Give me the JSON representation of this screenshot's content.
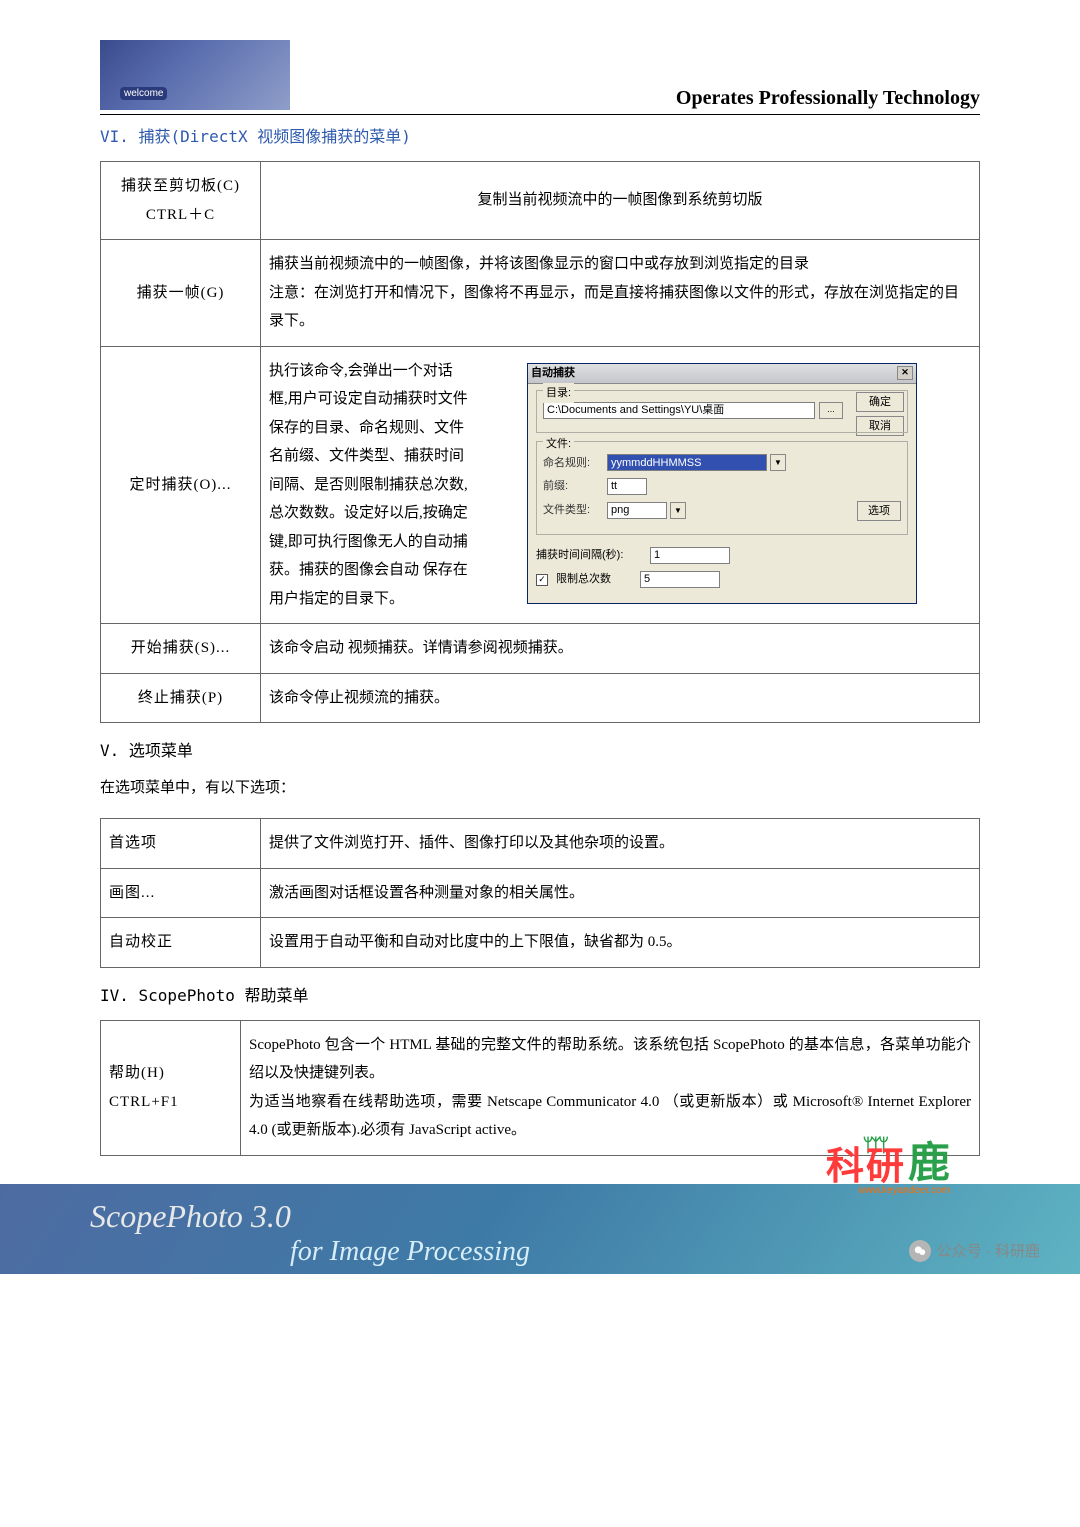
{
  "header": {
    "title": "Operates Professionally Technology"
  },
  "section6_title": "VI. 捕获(DirectX 视频图像捕获的菜单)",
  "table1": {
    "r1": {
      "label": "捕获至剪切板(C)   CTRL＋C",
      "desc": "复制当前视频流中的一帧图像到系统剪切版"
    },
    "r2": {
      "label": "捕获一帧(G)",
      "desc": "捕获当前视频流中的一帧图像，并将该图像显示的窗口中或存放到浏览指定的目录\n注意：在浏览打开和情况下，图像将不再显示，而是直接将捕获图像以文件的形式，存放在浏览指定的目录下。"
    },
    "r3": {
      "label": "定时捕获(O)...",
      "desc": "执行该命令,会弹出一个对话框,用户可设定自动捕获时文件保存的目录、命名规则、文件名前缀、文件类型、捕获时间间隔、是否则限制捕获总次数,总次数数。设定好以后,按确定键,即可执行图像无人的自动捕获。捕获的图像会自动 保存在用户指定的目录下。"
    },
    "r4": {
      "label": "开始捕获(S)...",
      "desc": "该命令启动 视频捕获。详情请参阅视频捕获。"
    },
    "r5": {
      "label": "终止捕获(P)",
      "desc": "该命令停止视频流的捕获。"
    }
  },
  "dialog": {
    "title": "自动捕获",
    "ok": "确定",
    "cancel": "取消",
    "grp_dir": "目录:",
    "path": "C:\\Documents and Settings\\YU\\桌面",
    "grp_file": "文件:",
    "rule_label": "命名规则:",
    "rule_value": "yymmddHHMMSS",
    "prefix_label": "前缀:",
    "prefix_value": "tt",
    "type_label": "文件类型:",
    "type_value": "png",
    "options_btn": "选项",
    "interval_label": "捕获时间间隔(秒):",
    "interval_value": "1",
    "limit_label": "限制总次数",
    "limit_value": "5"
  },
  "section5_title": "V. 选项菜单",
  "section5_intro": "在选项菜单中，有以下选项：",
  "table2": {
    "r1": {
      "label": "首选项",
      "desc": "提供了文件浏览打开、插件、图像打印以及其他杂项的设置。"
    },
    "r2": {
      "label": "画图...",
      "desc": "激活画图对话框设置各种测量对象的相关属性。"
    },
    "r3": {
      "label": "自动校正",
      "desc": "设置用于自动平衡和自动对比度中的上下限值，缺省都为 0.5。"
    }
  },
  "section4_title": "IV. ScopePhoto 帮助菜单",
  "table3": {
    "r1": {
      "label": "帮助(H)\nCTRL+F1",
      "desc": "ScopePhoto 包含一个 HTML 基础的完整文件的帮助系统。该系统包括 ScopePhoto   的基本信息，各菜单功能介绍以及快捷键列表。\n为适当地察看在线帮助选项，需要 Netscape Communicator 4.0 （或更新版本）或 Microsoft® Internet Explorer 4.0 (或更新版本).必须有 JavaScript active。"
    }
  },
  "footer": {
    "brand": "ScopePhoto 3.0",
    "sub": "for Image Processing"
  },
  "watermark": {
    "red": "科研",
    "green": "鹿",
    "site": "www.keyandeer.com",
    "wx": "公众号 · 科研鹿"
  }
}
